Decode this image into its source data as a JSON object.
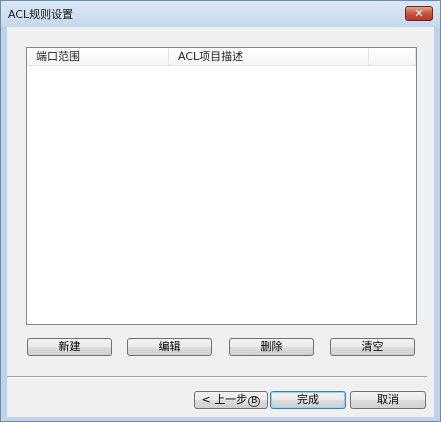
{
  "window": {
    "title": "ACL规则设置",
    "close_label": "✕"
  },
  "list": {
    "columns": [
      "端口范围",
      "ACL项目描述",
      ""
    ],
    "rows": []
  },
  "actions": {
    "new_label": "新建",
    "edit_label": "编辑",
    "delete_label": "删除",
    "clear_label": "清空"
  },
  "nav": {
    "back_label": "< 上一步",
    "back_key": "B",
    "finish_label": "完成",
    "cancel_label": "取消"
  }
}
